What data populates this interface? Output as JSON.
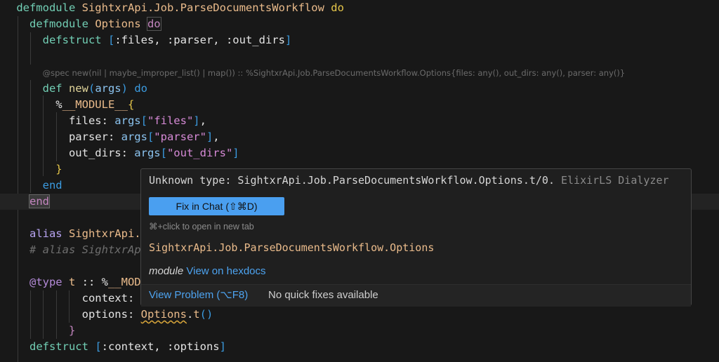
{
  "editor": {
    "lines": [
      {
        "indent": 2.5,
        "tokens": [
          [
            "kw",
            "defmodule "
          ],
          [
            "mod",
            "SightxrApi.Job.ParseDocumentsWorkflow "
          ],
          [
            "do",
            "do"
          ]
        ]
      },
      {
        "indent": 4.5,
        "tokens": [
          [
            "kw",
            "defmodule "
          ],
          [
            "mod",
            "Options "
          ],
          [
            "dom",
            "do"
          ]
        ]
      },
      {
        "indent": 6.5,
        "tokens": [
          [
            "kw",
            "defstruct "
          ],
          [
            "br",
            "["
          ],
          [
            "plain",
            ":files, :parser, :out_dirs"
          ],
          [
            "br",
            "]"
          ]
        ]
      },
      {
        "indent": 6.5,
        "tokens": []
      },
      {
        "indent": 6.5,
        "spec": true,
        "tokens": [
          [
            "spec",
            "@spec new(nil | maybe_improper_list() | map()) :: %SightxrApi.Job.ParseDocumentsWorkflow.Options{files: any(), out_dirs: any(), parser: any()}"
          ]
        ]
      },
      {
        "indent": 6.5,
        "tokens": [
          [
            "kw",
            "def "
          ],
          [
            "fn",
            "new"
          ],
          [
            "br",
            "("
          ],
          [
            "var",
            "args"
          ],
          [
            "br",
            ")"
          ],
          [
            "plain",
            " "
          ],
          [
            "end",
            "do"
          ]
        ]
      },
      {
        "indent": 8.5,
        "tokens": [
          [
            "plain",
            "%"
          ],
          [
            "mod",
            "__MODULE__"
          ],
          [
            "curly",
            "{"
          ]
        ]
      },
      {
        "indent": 10.5,
        "tokens": [
          [
            "plain",
            "files: "
          ],
          [
            "var",
            "args"
          ],
          [
            "br",
            "["
          ],
          [
            "str",
            "\"files\""
          ],
          [
            "br",
            "]"
          ],
          [
            "plain",
            ","
          ]
        ]
      },
      {
        "indent": 10.5,
        "tokens": [
          [
            "plain",
            "parser: "
          ],
          [
            "var",
            "args"
          ],
          [
            "br",
            "["
          ],
          [
            "str",
            "\"parser\""
          ],
          [
            "br",
            "]"
          ],
          [
            "plain",
            ","
          ]
        ]
      },
      {
        "indent": 10.5,
        "tokens": [
          [
            "plain",
            "out_dirs: "
          ],
          [
            "var",
            "args"
          ],
          [
            "br",
            "["
          ],
          [
            "str",
            "\"out_dirs\""
          ],
          [
            "br",
            "]"
          ]
        ]
      },
      {
        "indent": 8.5,
        "tokens": [
          [
            "curly",
            "}"
          ]
        ]
      },
      {
        "indent": 6.5,
        "tokens": [
          [
            "end",
            "end"
          ]
        ]
      },
      {
        "indent": 4.5,
        "current": true,
        "tokens": [
          [
            "endm",
            "end"
          ]
        ]
      },
      {
        "indent": 4.5,
        "tokens": []
      },
      {
        "indent": 4.5,
        "tokens": [
          [
            "alias",
            "alias "
          ],
          [
            "mod",
            "SightxrApi."
          ]
        ]
      },
      {
        "indent": 4.5,
        "tokens": [
          [
            "cmt",
            "# alias SightxrAp"
          ]
        ]
      },
      {
        "indent": 4.5,
        "tokens": []
      },
      {
        "indent": 4.5,
        "tokens": [
          [
            "attr",
            "@type "
          ],
          [
            "mod",
            "t "
          ],
          [
            "plain",
            ":: %"
          ],
          [
            "mod",
            "__MOD"
          ]
        ]
      },
      {
        "indent": 12.5,
        "tokens": [
          [
            "plain",
            "context:"
          ]
        ]
      },
      {
        "indent": 12.5,
        "tokens": [
          [
            "plain",
            "options: "
          ],
          [
            "err",
            "Options"
          ],
          [
            "plain",
            "."
          ],
          [
            "mod",
            "t"
          ],
          [
            "br",
            "()"
          ]
        ]
      },
      {
        "indent": 10.5,
        "tokens": [
          [
            "curlyp",
            "}"
          ]
        ]
      },
      {
        "indent": 4.5,
        "tokens": [
          [
            "kw",
            "defstruct "
          ],
          [
            "br",
            "["
          ],
          [
            "plain",
            ":context, :options"
          ],
          [
            "br",
            "]"
          ]
        ]
      }
    ]
  },
  "hover": {
    "message": "Unknown type: SightxrApi.Job.ParseDocumentsWorkflow.Options.t/0.",
    "source": "ElixirLS Dialyzer",
    "fix_button": "Fix in Chat (⇧⌘D)",
    "hint": "⌘+click to open in new tab",
    "module_name": "SightxrApi.Job.ParseDocumentsWorkflow.Options",
    "kind": "module",
    "hexdocs_link": "View on hexdocs",
    "view_problem": "View Problem (⌥F8)",
    "no_fixes": "No quick fixes available"
  }
}
